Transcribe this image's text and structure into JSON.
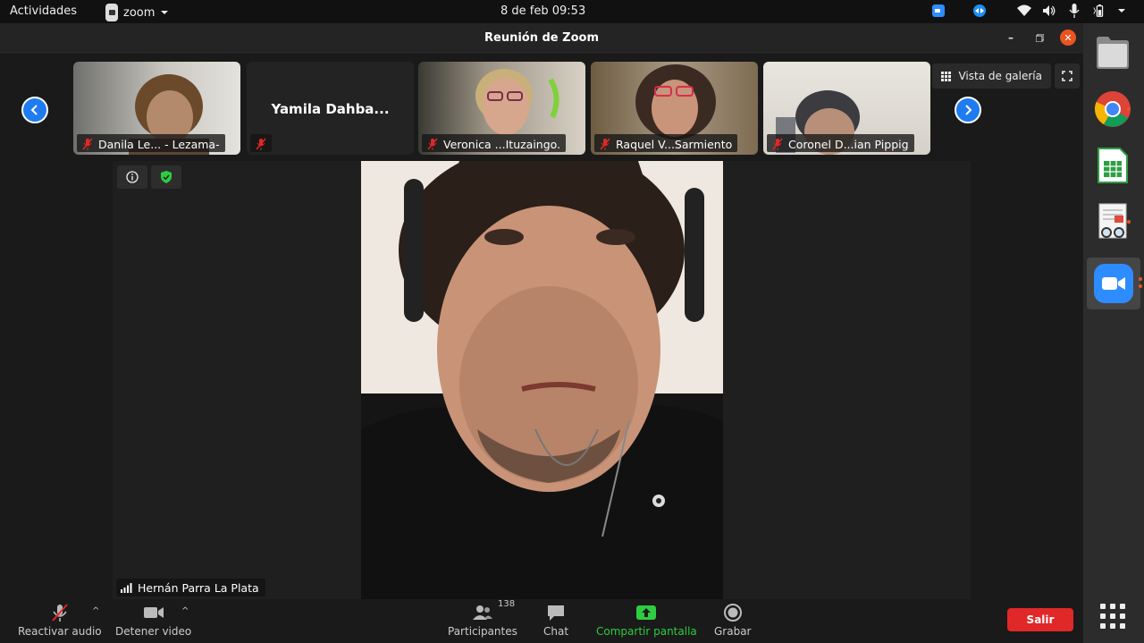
{
  "topbar": {
    "activities": "Actividades",
    "app_name": "zoom",
    "clock": "8 de feb  09:53"
  },
  "window": {
    "title": "Reunión de Zoom"
  },
  "gallery_button": "Vista de galería",
  "participants_strip": [
    {
      "name": "Danila Le... - Lezama-",
      "muted": true,
      "video": true
    },
    {
      "name": "",
      "display_name": "Yamila Dahba...",
      "muted": true,
      "video": false
    },
    {
      "name": "Veronica ...Ituzaingo.",
      "muted": true,
      "video": true
    },
    {
      "name": "Raquel V...Sarmiento",
      "muted": true,
      "video": true
    },
    {
      "name": "Coronel D...ian Pippig",
      "muted": true,
      "video": true
    }
  ],
  "active_speaker": {
    "name": "Hernán Parra La Plata"
  },
  "toolbar": {
    "unmute": "Reactivar audio",
    "stop_video": "Detener video",
    "participants": "Participantes",
    "participants_count": "138",
    "chat": "Chat",
    "share": "Compartir pantalla",
    "record": "Grabar",
    "leave": "Salir"
  },
  "colors": {
    "accent_blue": "#1e7cf0",
    "share_green": "#2ecc40",
    "leave_red": "#e02828",
    "ubuntu_orange": "#e95420"
  },
  "dock": {
    "items": [
      "files-icon",
      "chrome-icon",
      "spreadsheet-icon",
      "document-viewer-icon",
      "zoom-icon",
      "app-grid-icon"
    ]
  }
}
